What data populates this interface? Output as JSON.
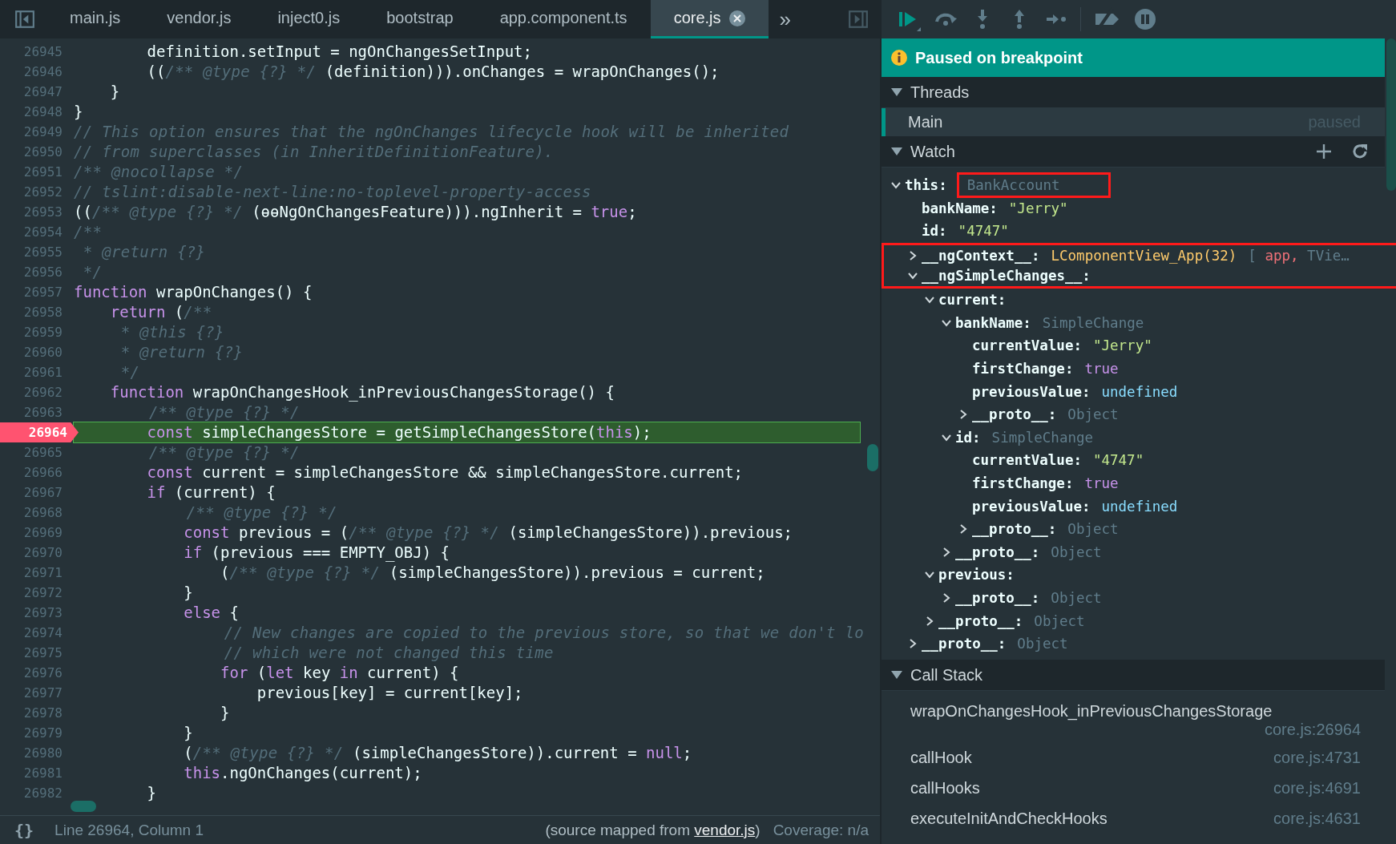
{
  "editor": {
    "tabs": [
      {
        "label": "main.js",
        "selected": false,
        "closable": false
      },
      {
        "label": "vendor.js",
        "selected": false,
        "closable": false
      },
      {
        "label": "inject0.js",
        "selected": false,
        "closable": false
      },
      {
        "label": "bootstrap",
        "selected": false,
        "closable": false
      },
      {
        "label": "app.component.ts",
        "selected": false,
        "closable": false
      },
      {
        "label": "core.js",
        "selected": true,
        "closable": true
      }
    ],
    "overflow": "»",
    "lines": [
      {
        "number": "26945",
        "breakpoint": false,
        "parts": [
          {
            "kind": "plain",
            "text": "        definition.setInput = ngOnChangesSetInput;"
          }
        ]
      },
      {
        "number": "26946",
        "breakpoint": false,
        "parts": [
          {
            "kind": "plain",
            "text": "        (("
          },
          {
            "kind": "comment",
            "text": "/** @type {?} */"
          },
          {
            "kind": "plain",
            "text": " (definition))).onChanges = wrapOnChanges();"
          }
        ]
      },
      {
        "number": "26947",
        "breakpoint": false,
        "parts": [
          {
            "kind": "plain",
            "text": "    }"
          }
        ]
      },
      {
        "number": "26948",
        "breakpoint": false,
        "parts": [
          {
            "kind": "plain",
            "text": "}"
          }
        ]
      },
      {
        "number": "26949",
        "breakpoint": false,
        "parts": [
          {
            "kind": "comment",
            "text": "// This option ensures that the ngOnChanges lifecycle hook will be inherited"
          }
        ]
      },
      {
        "number": "26950",
        "breakpoint": false,
        "parts": [
          {
            "kind": "comment",
            "text": "// from superclasses (in InheritDefinitionFeature)."
          }
        ]
      },
      {
        "number": "26951",
        "breakpoint": false,
        "parts": [
          {
            "kind": "comment",
            "text": "/** @nocollapse */"
          }
        ]
      },
      {
        "number": "26952",
        "breakpoint": false,
        "parts": [
          {
            "kind": "comment",
            "text": "// tslint:disable-next-line:no-toplevel-property-access"
          }
        ]
      },
      {
        "number": "26953",
        "breakpoint": false,
        "parts": [
          {
            "kind": "plain",
            "text": "(("
          },
          {
            "kind": "comment",
            "text": "/** @type {?} */"
          },
          {
            "kind": "plain",
            "text": " (ɵɵNgOnChangesFeature))).ngInherit = "
          },
          {
            "kind": "keyword",
            "text": "true"
          },
          {
            "kind": "plain",
            "text": ";"
          }
        ]
      },
      {
        "number": "26954",
        "breakpoint": false,
        "parts": [
          {
            "kind": "comment",
            "text": "/**"
          }
        ]
      },
      {
        "number": "26955",
        "breakpoint": false,
        "parts": [
          {
            "kind": "comment",
            "text": " * @return {?}"
          }
        ]
      },
      {
        "number": "26956",
        "breakpoint": false,
        "parts": [
          {
            "kind": "comment",
            "text": " */"
          }
        ]
      },
      {
        "number": "26957",
        "breakpoint": false,
        "parts": [
          {
            "kind": "keyword",
            "text": "function"
          },
          {
            "kind": "plain",
            "text": " wrapOnChanges() {"
          }
        ]
      },
      {
        "number": "26958",
        "breakpoint": false,
        "parts": [
          {
            "kind": "keyword",
            "text": "    return"
          },
          {
            "kind": "plain",
            "text": " ("
          },
          {
            "kind": "comment",
            "text": "/**"
          }
        ]
      },
      {
        "number": "26959",
        "breakpoint": false,
        "parts": [
          {
            "kind": "comment",
            "text": "     * @this {?}"
          }
        ]
      },
      {
        "number": "26960",
        "breakpoint": false,
        "parts": [
          {
            "kind": "comment",
            "text": "     * @return {?}"
          }
        ]
      },
      {
        "number": "26961",
        "breakpoint": false,
        "parts": [
          {
            "kind": "comment",
            "text": "     */"
          }
        ]
      },
      {
        "number": "26962",
        "breakpoint": false,
        "parts": [
          {
            "kind": "keyword",
            "text": "    function"
          },
          {
            "kind": "plain",
            "text": " wrapOnChangesHook_inPreviousChangesStorage() {"
          }
        ]
      },
      {
        "number": "26963",
        "breakpoint": false,
        "parts": [
          {
            "kind": "comment",
            "text": "        /** @type {?} */"
          }
        ]
      },
      {
        "number": "26964",
        "breakpoint": true,
        "parts": [
          {
            "kind": "keyword",
            "text": "        const"
          },
          {
            "kind": "plain",
            "text": " simpleChangesStore = getSimpleChangesStore("
          },
          {
            "kind": "keyword",
            "text": "this"
          },
          {
            "kind": "plain",
            "text": ");"
          }
        ]
      },
      {
        "number": "26965",
        "breakpoint": false,
        "parts": [
          {
            "kind": "comment",
            "text": "        /** @type {?} */"
          }
        ]
      },
      {
        "number": "26966",
        "breakpoint": false,
        "parts": [
          {
            "kind": "keyword",
            "text": "        const"
          },
          {
            "kind": "plain",
            "text": " current = simpleChangesStore && simpleChangesStore.current;"
          }
        ]
      },
      {
        "number": "26967",
        "breakpoint": false,
        "parts": [
          {
            "kind": "keyword",
            "text": "        if"
          },
          {
            "kind": "plain",
            "text": " (current) {"
          }
        ]
      },
      {
        "number": "26968",
        "breakpoint": false,
        "parts": [
          {
            "kind": "comment",
            "text": "            /** @type {?} */"
          }
        ]
      },
      {
        "number": "26969",
        "breakpoint": false,
        "parts": [
          {
            "kind": "keyword",
            "text": "            const"
          },
          {
            "kind": "plain",
            "text": " previous = ("
          },
          {
            "kind": "comment",
            "text": "/** @type {?} */"
          },
          {
            "kind": "plain",
            "text": " (simpleChangesStore)).previous;"
          }
        ]
      },
      {
        "number": "26970",
        "breakpoint": false,
        "parts": [
          {
            "kind": "keyword",
            "text": "            if"
          },
          {
            "kind": "plain",
            "text": " (previous === EMPTY_OBJ) {"
          }
        ]
      },
      {
        "number": "26971",
        "breakpoint": false,
        "parts": [
          {
            "kind": "plain",
            "text": "                ("
          },
          {
            "kind": "comment",
            "text": "/** @type {?} */"
          },
          {
            "kind": "plain",
            "text": " (simpleChangesStore)).previous = current;"
          }
        ]
      },
      {
        "number": "26972",
        "breakpoint": false,
        "parts": [
          {
            "kind": "plain",
            "text": "            }"
          }
        ]
      },
      {
        "number": "26973",
        "breakpoint": false,
        "parts": [
          {
            "kind": "keyword",
            "text": "            else"
          },
          {
            "kind": "plain",
            "text": " {"
          }
        ]
      },
      {
        "number": "26974",
        "breakpoint": false,
        "parts": [
          {
            "kind": "comment",
            "text": "                // New changes are copied to the previous store, so that we don't lo"
          }
        ]
      },
      {
        "number": "26975",
        "breakpoint": false,
        "parts": [
          {
            "kind": "comment",
            "text": "                // which were not changed this time"
          }
        ]
      },
      {
        "number": "26976",
        "breakpoint": false,
        "parts": [
          {
            "kind": "keyword",
            "text": "                for"
          },
          {
            "kind": "plain",
            "text": " ("
          },
          {
            "kind": "keyword",
            "text": "let"
          },
          {
            "kind": "plain",
            "text": " key "
          },
          {
            "kind": "keyword",
            "text": "in"
          },
          {
            "kind": "plain",
            "text": " current) {"
          }
        ]
      },
      {
        "number": "26977",
        "breakpoint": false,
        "parts": [
          {
            "kind": "plain",
            "text": "                    previous[key] = current[key];"
          }
        ]
      },
      {
        "number": "26978",
        "breakpoint": false,
        "parts": [
          {
            "kind": "plain",
            "text": "                }"
          }
        ]
      },
      {
        "number": "26979",
        "breakpoint": false,
        "parts": [
          {
            "kind": "plain",
            "text": "            }"
          }
        ]
      },
      {
        "number": "26980",
        "breakpoint": false,
        "parts": [
          {
            "kind": "plain",
            "text": "            ("
          },
          {
            "kind": "comment",
            "text": "/** @type {?} */"
          },
          {
            "kind": "plain",
            "text": " (simpleChangesStore)).current = "
          },
          {
            "kind": "keyword",
            "text": "null"
          },
          {
            "kind": "plain",
            "text": ";"
          }
        ]
      },
      {
        "number": "26981",
        "breakpoint": false,
        "parts": [
          {
            "kind": "keyword",
            "text": "            this"
          },
          {
            "kind": "plain",
            "text": ".ngOnChanges(current);"
          }
        ]
      },
      {
        "number": "26982",
        "breakpoint": false,
        "parts": [
          {
            "kind": "plain",
            "text": "        }"
          }
        ]
      }
    ]
  },
  "status_bar": {
    "format": "{}",
    "position": "Line 26964, Column 1",
    "source_prefix": "(source mapped from ",
    "source_link": "vendor.js",
    "source_suffix": ")",
    "coverage": "Coverage: n/a"
  },
  "debugger": {
    "banner": "Paused on breakpoint",
    "threads": {
      "title": "Threads",
      "expanded": true,
      "items": [
        {
          "name": "Main",
          "state": "paused",
          "selected": true
        }
      ]
    },
    "watch": {
      "title": "Watch",
      "expanded": true,
      "tree": [
        {
          "key": "this:",
          "value": "BankAccount",
          "kind": "type",
          "value_highlighted": true,
          "expanded": true,
          "children": [
            {
              "key": "bankName:",
              "value": "\"Jerry\"",
              "kind": "string"
            },
            {
              "key": "id:",
              "value": "\"4747\"",
              "kind": "string"
            },
            {
              "key": "__ngContext__:",
              "value": "LComponentView_App(32)",
              "kind": "class",
              "highlighted": true,
              "expanded": false,
              "preview": [
                {
                  "kind": "punct",
                  "text": "["
                },
                {
                  "kind": "name",
                  "text": "app,"
                },
                {
                  "kind": "punct",
                  "text": "TVie…"
                }
              ]
            },
            {
              "key": "__ngSimpleChanges__:",
              "highlighted": true,
              "expanded": true,
              "children": [
                {
                  "key": "current:",
                  "expanded": true,
                  "children": [
                    {
                      "key": "bankName:",
                      "value": "SimpleChange",
                      "kind": "type",
                      "expanded": true,
                      "children": [
                        {
                          "key": "currentValue:",
                          "value": "\"Jerry\"",
                          "kind": "string"
                        },
                        {
                          "key": "firstChange:",
                          "value": "true",
                          "kind": "literal"
                        },
                        {
                          "key": "previousValue:",
                          "value": "undefined",
                          "kind": "undefined"
                        },
                        {
                          "key": "__proto__:",
                          "value": "Object",
                          "kind": "type",
                          "expanded": false
                        }
                      ]
                    },
                    {
                      "key": "id:",
                      "value": "SimpleChange",
                      "kind": "type",
                      "expanded": true,
                      "children": [
                        {
                          "key": "currentValue:",
                          "value": "\"4747\"",
                          "kind": "string"
                        },
                        {
                          "key": "firstChange:",
                          "value": "true",
                          "kind": "literal"
                        },
                        {
                          "key": "previousValue:",
                          "value": "undefined",
                          "kind": "undefined"
                        },
                        {
                          "key": "__proto__:",
                          "value": "Object",
                          "kind": "type",
                          "expanded": false
                        }
                      ]
                    },
                    {
                      "key": "__proto__:",
                      "value": "Object",
                      "kind": "type",
                      "expanded": false
                    }
                  ]
                },
                {
                  "key": "previous:",
                  "expanded": true,
                  "children": [
                    {
                      "key": "__proto__:",
                      "value": "Object",
                      "kind": "type",
                      "expanded": false
                    }
                  ]
                },
                {
                  "key": "__proto__:",
                  "value": "Object",
                  "kind": "type",
                  "expanded": false
                }
              ]
            },
            {
              "key": "__proto__:",
              "value": "Object",
              "kind": "type",
              "expanded": false
            }
          ]
        }
      ]
    },
    "call_stack": {
      "title": "Call Stack",
      "expanded": true,
      "frames": [
        {
          "name": "wrapOnChangesHook_inPreviousChangesStorage",
          "location": "core.js:26964",
          "wrapped": true
        },
        {
          "name": "callHook",
          "location": "core.js:4731",
          "wrapped": false
        },
        {
          "name": "callHooks",
          "location": "core.js:4691",
          "wrapped": false
        },
        {
          "name": "executeInitAndCheckHooks",
          "location": "core.js:4631",
          "wrapped": false
        }
      ]
    }
  }
}
